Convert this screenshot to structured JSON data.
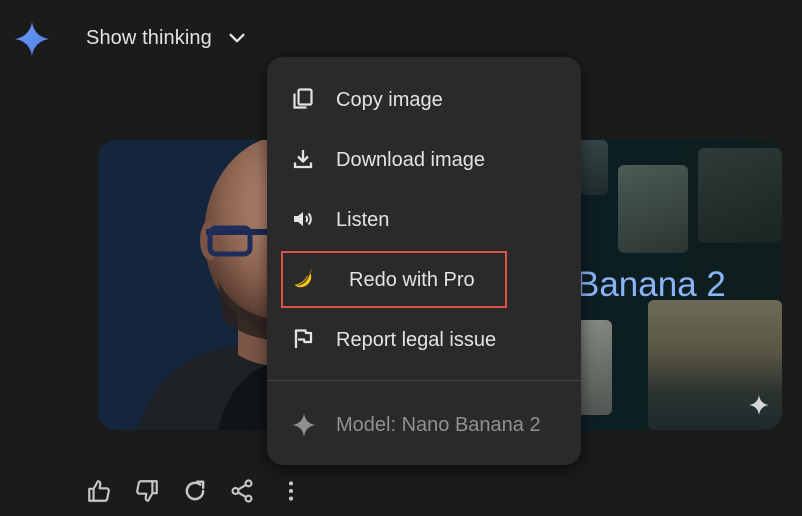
{
  "header": {
    "show_thinking_label": "Show thinking"
  },
  "image_card": {
    "headline": "Banana 2"
  },
  "menu": {
    "items": [
      {
        "label": "Copy image",
        "icon": "copy-icon"
      },
      {
        "label": "Download image",
        "icon": "download-icon"
      },
      {
        "label": "Listen",
        "icon": "speaker-icon"
      },
      {
        "label": "Redo with Pro",
        "icon": "banana-icon"
      },
      {
        "label": "Report legal issue",
        "icon": "flag-icon"
      }
    ],
    "model_label": "Model: Nano Banana 2"
  },
  "actions": [
    "thumbs-up-icon",
    "thumbs-down-icon",
    "redo-icon",
    "share-icon",
    "more-vert-icon"
  ],
  "colors": {
    "accent_blue": "#8ab4f8",
    "highlight_red": "#e0514b",
    "menu_bg": "#2a2a2a",
    "page_bg": "#1b1b1b"
  }
}
